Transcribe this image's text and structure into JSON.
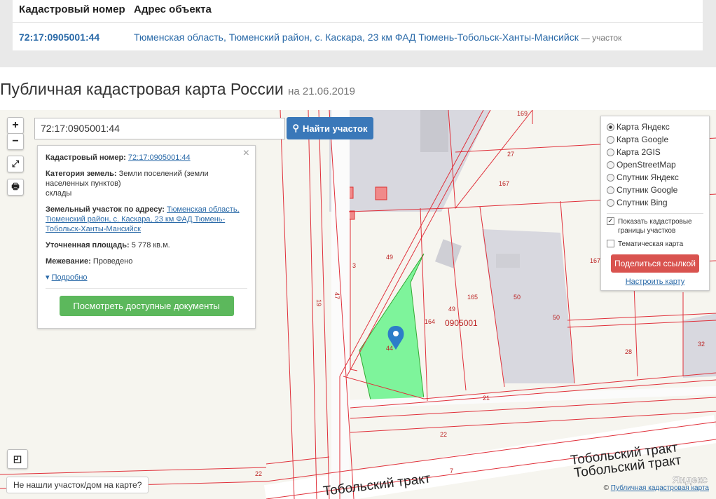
{
  "table": {
    "col_number": "Кадастровый номер",
    "col_address": "Адрес объекта",
    "row": {
      "number": "72:17:0905001:44",
      "address": "Тюменская область, Тюменский район, с. Каскара, 23 км ФАД Тюмень-Тобольск-Ханты-Мансийск",
      "type": "— участок"
    }
  },
  "page_title": "Публичная кадастровая карта России",
  "page_date": "на 21.06.2019",
  "map": {
    "zoom_in": "+",
    "zoom_out": "−",
    "search_value": "72:17:0905001:44",
    "find_button": "Найти участок",
    "info": {
      "cad_label": "Кадастровый номер:",
      "cad_value": "72:17:0905001:44",
      "category_label": "Категория земель:",
      "category_value": "Земли поселений (земли населенных пунктов)",
      "category_extra": "склады",
      "address_label": "Земельный участок по адресу:",
      "address_value": "Тюменская область, Тюменский район, с. Каскара, 23 км ФАД Тюмень-Тобольск-Ханты-Мансийск",
      "area_label": "Уточненная площадь:",
      "area_value": "5 778 кв.м.",
      "survey_label": "Межевание:",
      "survey_value": "Проведено",
      "more": "Подробно",
      "docs_button": "Посмотреть доступные документы",
      "close": "×"
    },
    "layers": {
      "options": [
        "Карта Яндекс",
        "Карта Google",
        "Карта 2GIS",
        "OpenStreetMap",
        "Спутник Яндекс",
        "Спутник Google",
        "Спутник Bing"
      ],
      "selected": "Карта Яндекс",
      "show_borders": "Показать кадастровые границы участков",
      "thematic": "Тематическая карта",
      "share_button": "Поделиться ссылкой",
      "setup_link": "Настроить карту"
    },
    "not_found": "Не нашли участок/дом на карте?",
    "attribution": "Публичная кадастровая карта",
    "road_1": "Тобольский тракт",
    "road_2": "Тобольский тракт",
    "road_3": "Тобольский тракт",
    "yandex": "Яндекс",
    "labels": {
      "l169": "169",
      "l27": "27",
      "l167": "167",
      "l167b": "167",
      "l49": "49",
      "l3": "3",
      "l165": "165",
      "l49b": "49",
      "l164": "164",
      "l0905001": "0905001",
      "l50": "50",
      "l50b": "50",
      "l28": "28",
      "l32": "32",
      "l44": "44",
      "l21": "21",
      "l22": "22",
      "l22b": "22",
      "l19": "19",
      "l47": "47",
      "l7": "7"
    },
    "colors": {
      "parcel": "#7ef49b",
      "boundary": "#e0303a",
      "building": "#d8d8df"
    }
  }
}
